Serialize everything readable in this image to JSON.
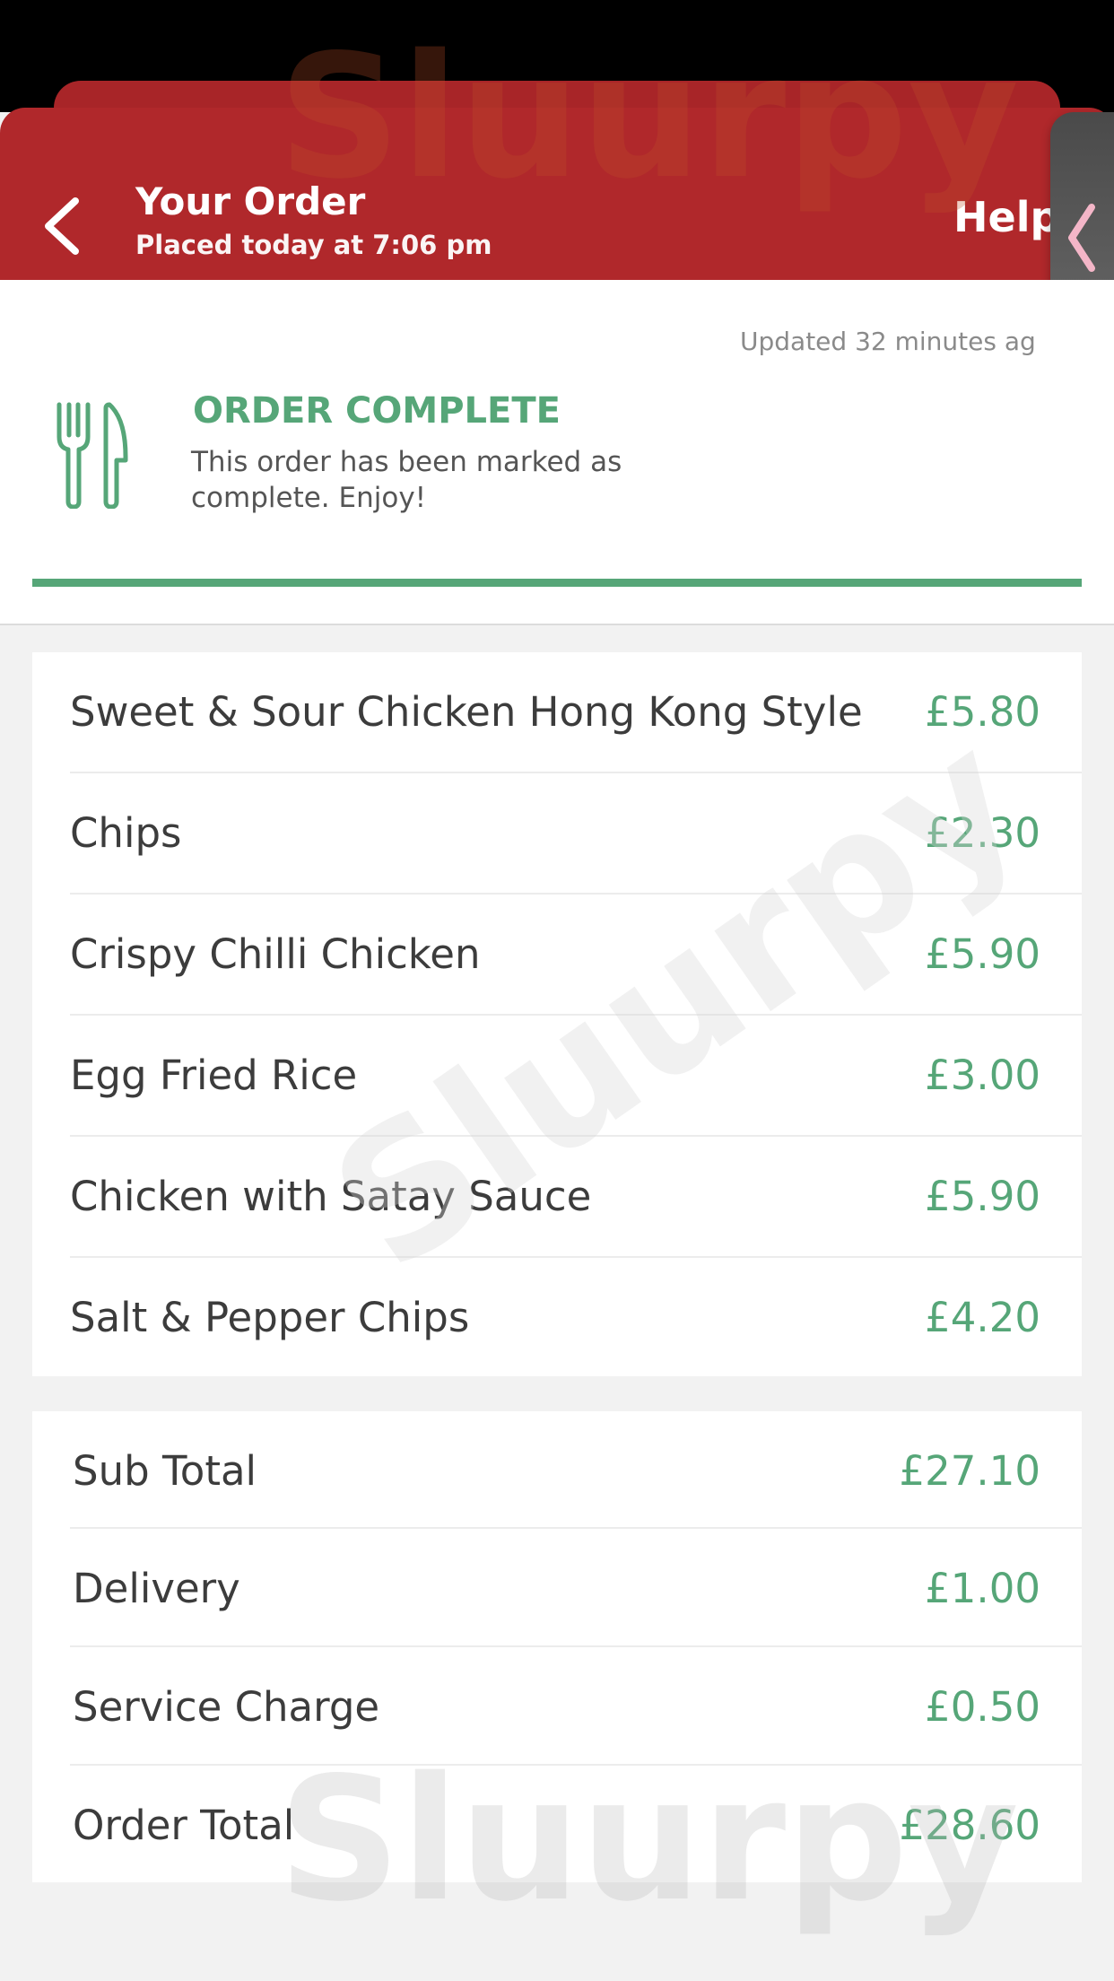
{
  "header": {
    "title": "Your Order",
    "subtitle": "Placed today at 7:06 pm",
    "help_label": "Help"
  },
  "status": {
    "updated": "Updated 32 minutes ag",
    "title": "ORDER COMPLETE",
    "message": "This order has been marked as complete. Enjoy!",
    "progress_percent": 100
  },
  "items": [
    {
      "name": "Sweet & Sour Chicken Hong Kong Style",
      "price": "£5.80"
    },
    {
      "name": "Chips",
      "price": "£2.30"
    },
    {
      "name": "Crispy Chilli Chicken",
      "price": "£5.90"
    },
    {
      "name": "Egg Fried Rice",
      "price": "£3.00"
    },
    {
      "name": "Chicken with Satay Sauce",
      "price": "£5.90"
    },
    {
      "name": "Salt & Pepper Chips",
      "price": "£4.20"
    }
  ],
  "totals": [
    {
      "name": "Sub Total",
      "price": "£27.10"
    },
    {
      "name": "Delivery",
      "price": "£1.00"
    },
    {
      "name": "Service Charge",
      "price": "£0.50"
    },
    {
      "name": "Order Total",
      "price": "£28.60"
    }
  ],
  "watermark": "Sluurpy",
  "colors": {
    "header": "#b0282b",
    "accent_green": "#56a678",
    "background": "#f2f2f2"
  },
  "icons": {
    "back": "chevron-left-icon",
    "cutlery": "fork-knife-icon",
    "handle": "chevron-left-icon"
  }
}
